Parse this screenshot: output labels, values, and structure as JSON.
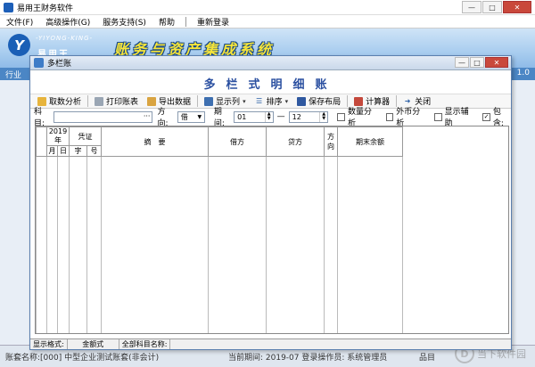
{
  "app": {
    "title": "易用王财务软件",
    "window_buttons": [
      "—",
      "□",
      "✕"
    ]
  },
  "menu": {
    "items": [
      "文件(F)",
      "高级操作(G)",
      "服务支持(S)",
      "帮助"
    ],
    "relogin": "重新登录"
  },
  "banner": {
    "logo_letter": "Y",
    "logo_en": "-YIYONG-KING-",
    "logo_cn": "易用王",
    "title": "账务与资产集成系统",
    "strip_left": "行业",
    "strip_right": "1.0"
  },
  "status": {
    "s1": "账套名称:[000] 中型企业测试账套(非会计)",
    "s2": "当前期间: 2019-07  登录操作员: 系统管理员",
    "s3": "品目"
  },
  "watermark": {
    "symbol": "D",
    "text": "当下软件园"
  },
  "window": {
    "title": "多栏账",
    "heading": "多栏式明细账"
  },
  "toolbar": {
    "fetch": "取数分析",
    "print": "打印账表",
    "export": "导出数据",
    "show_cols": "显示列",
    "sort": "排序",
    "save_layout": "保存布局",
    "calculator": "计算器",
    "close": "关闭"
  },
  "filter": {
    "subject_label": "科目:",
    "subject_value": "",
    "dots": "···",
    "direction_label": "方向:",
    "direction_value": "借",
    "period_label": "期间:",
    "period_from": "01",
    "dash": "—",
    "period_to": "12",
    "qty_label": "数量分析",
    "fx_label": "外币分析",
    "aux_label": "显示辅助",
    "include_label": "包含:",
    "include_checked": "✓"
  },
  "grid": {
    "year": "2019年",
    "voucher": "凭证",
    "month": "月",
    "day": "日",
    "zi": "字",
    "hao": "号",
    "summary": "摘　要",
    "debit": "借方",
    "credit": "贷方",
    "direction": "方向",
    "balance": "期末余额"
  },
  "inner_status": {
    "format_label": "显示格式:",
    "format_value": "金额式",
    "allname_label": "全部科目名称:"
  },
  "colors": {
    "heading": "#2a4fa0",
    "banner_title": "#f6e53a",
    "brand": "#1a5fb6"
  }
}
